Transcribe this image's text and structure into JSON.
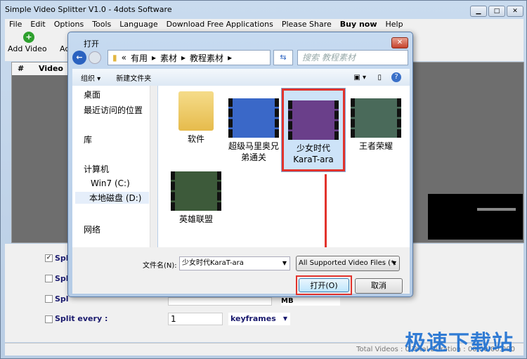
{
  "window": {
    "title": "Simple Video Splitter V1.0 - 4dots Software",
    "controls": [
      "minimize",
      "maximize",
      "close"
    ]
  },
  "menu": [
    "File",
    "Edit",
    "Options",
    "Tools",
    "Language",
    "Download Free Applications",
    "Please Share",
    "Buy now",
    "Help"
  ],
  "toolbar": {
    "add_video": "Add Video",
    "add_partial": "Ad"
  },
  "list": {
    "columns": [
      "#",
      "Video"
    ]
  },
  "options": [
    {
      "label": "Spl",
      "checked": true
    },
    {
      "label": "Spl",
      "checked": false
    },
    {
      "label": "Spl",
      "checked": false
    },
    {
      "label": "Split every :",
      "checked": false,
      "value": "1",
      "unit": "keyframes"
    }
  ],
  "partial_unit": "MB",
  "status": "Total Videos : 0  Total Duration : 00:00:00.000",
  "watermark": "极速下载站",
  "dialog": {
    "title": "打开",
    "breadcrumb": [
      "«",
      "有用",
      "素材",
      "教程素材"
    ],
    "search_placeholder": "搜索 教程素材",
    "organize": "组织 ▾",
    "new_folder": "新建文件夹",
    "nav": [
      "桌面",
      "最近访问的位置",
      "库",
      "计算机",
      "Win7 (C:)",
      "本地磁盘 (D:)",
      "网络"
    ],
    "files": [
      {
        "name": "软件",
        "type": "folder"
      },
      {
        "name": "超级马里奥兄弟通关",
        "type": "video"
      },
      {
        "name": "少女时代KaraT-ara",
        "type": "video",
        "selected": true
      },
      {
        "name": "王者荣耀",
        "type": "video"
      },
      {
        "name": "英雄联盟",
        "type": "video"
      }
    ],
    "filename_label": "文件名(N):",
    "filename_value": "少女时代KaraT-ara",
    "filetype": "All Supported Video Files (*.",
    "open_button": "打开(O)",
    "cancel_button": "取消"
  },
  "colors": {
    "highlight": "#e2332c",
    "watermark": "#1c6fd1"
  }
}
